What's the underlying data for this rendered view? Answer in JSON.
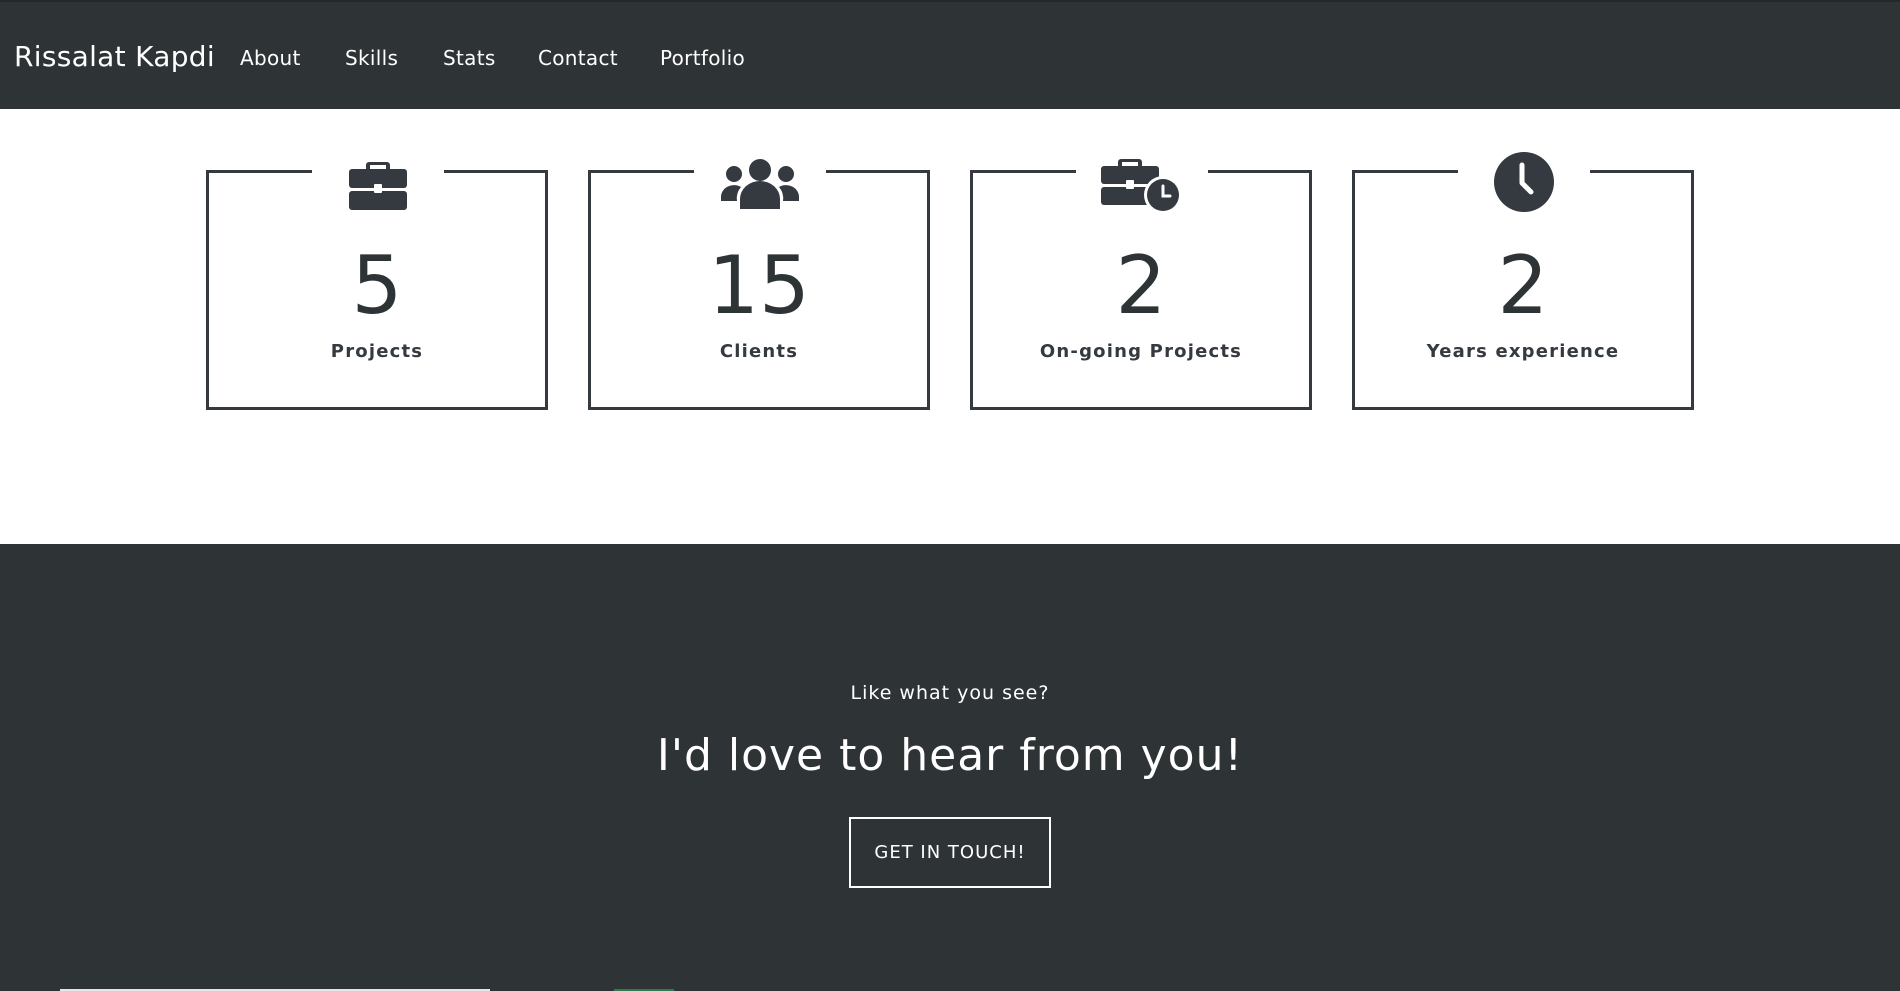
{
  "navbar": {
    "brand": "Rissalat Kapdi",
    "links": [
      {
        "label": "About"
      },
      {
        "label": "Skills"
      },
      {
        "label": "Stats"
      },
      {
        "label": "Contact"
      },
      {
        "label": "Portfolio"
      }
    ]
  },
  "stats": [
    {
      "icon": "briefcase-icon",
      "value": "5",
      "label": "Projects"
    },
    {
      "icon": "users-icon",
      "value": "15",
      "label": "Clients"
    },
    {
      "icon": "business-time-icon",
      "value": "2",
      "label": "On-going Projects"
    },
    {
      "icon": "clock-icon",
      "value": "2",
      "label": "Years experience"
    }
  ],
  "cta": {
    "kicker": "Like what you see?",
    "heading": "I'd love to hear from you!",
    "button_label": "GET IN TOUCH!"
  },
  "colors": {
    "dark": "#2e3336",
    "icon": "#343a40",
    "text_light": "#ffffff"
  }
}
